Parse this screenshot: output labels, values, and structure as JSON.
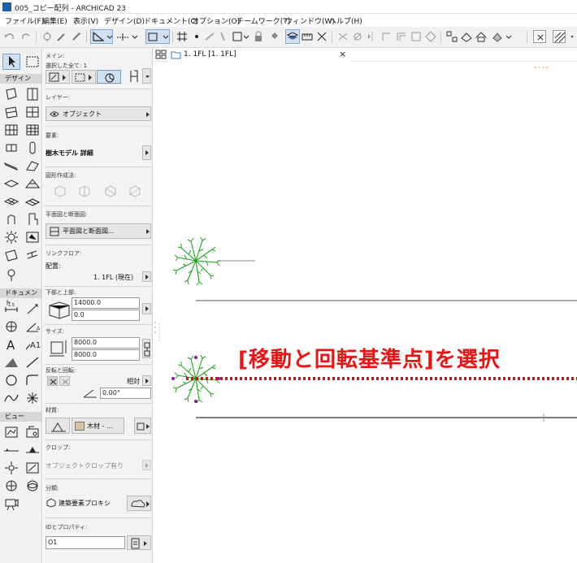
{
  "window": {
    "title": "005_コピー配列 - ARCHICAD 23"
  },
  "menubar": [
    "ファイル(F)",
    "編集(E)",
    "表示(V)",
    "デザイン(D)",
    "ドキュメント(C)",
    "オプション(O)",
    "チームワーク(T)",
    "ウィンドウ(W)",
    "ヘルプ(H)"
  ],
  "toolbox": {
    "section_design": "デザイン",
    "section_document": "ドキュメント",
    "section_view": "ビュー"
  },
  "infobox": {
    "main_label": "メイン:",
    "selected_count": "選択した全て: 1",
    "layer_label": "レイヤー:",
    "layer_value": "オブジェクト",
    "element_label": "要素:",
    "element_value": "樹木モデル 詳細",
    "geometry_label": "図形作成法:",
    "floor_plan_label": "平面図と断面図:",
    "floor_plan_button": "平面図と断面図...",
    "link_floor_label": "リンクフロア:",
    "placement_label": "配置:",
    "placement_value": "1. 1FL (現在)",
    "bottom_top_label": "下部と上部:",
    "top_value": "14000.0",
    "bottom_value": "0.0",
    "size_label": "サイズ:",
    "size_x": "8000.0",
    "size_y": "8000.0",
    "mirror_rotate_label": "反転と回転:",
    "relative_label": "相対",
    "angle_value": "0.00°",
    "material_label": "材質:",
    "material_value": "木材 - ...",
    "crop_label": "クロップ:",
    "crop_value": "オブジェクトクロップ有り",
    "classification_label": "分類:",
    "classification_value": "建築要素プロキシ",
    "id_label": "IDとプロパティ:",
    "id_value": "O1"
  },
  "document_tab": {
    "label": "1. 1FL [1. 1FL]",
    "close": "×"
  },
  "annotation": {
    "text": "[移動と回転基準点]を選択",
    "color": "#ee1111"
  },
  "colors": {
    "tree": "#1aa31a",
    "selection_dots": "#cc1111",
    "hotspots": "#8a1a9a",
    "selected_tool": "#cfe0f3"
  }
}
